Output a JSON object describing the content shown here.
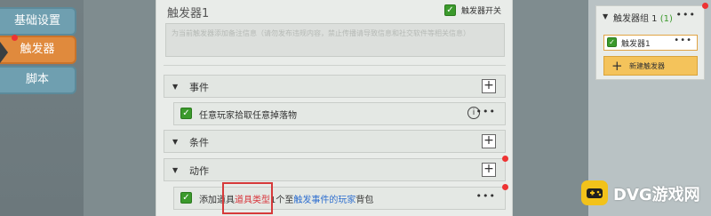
{
  "left_tabs": [
    {
      "label": "基础设置"
    },
    {
      "label": "触发器"
    },
    {
      "label": "脚本"
    }
  ],
  "trigger": {
    "title": "触发器1",
    "switch_label": "触发器开关",
    "switch_on": true,
    "note_placeholder": "为当前触发器添加备注信息（请勿发布违规内容，禁止传播请导致信息和社交软件等相关信息）"
  },
  "sections": {
    "event": {
      "label": "事件",
      "add": "+"
    },
    "condition": {
      "label": "条件",
      "add": "+"
    },
    "action": {
      "label": "动作",
      "add": "+"
    }
  },
  "event_row": {
    "text": "任意玩家拾取任意掉落物",
    "info": "i",
    "more": "•••"
  },
  "action_row": {
    "prefix": "添加道具",
    "item_type": "道具类型",
    "count": "1个至",
    "target": "触发事件的玩家",
    "suffix": "背包",
    "more": "•••"
  },
  "right_panel": {
    "group_label": "触发器组 1",
    "group_count": "(1)",
    "group_more": "•••",
    "item_label": "触发器1",
    "item_more": "•••",
    "new_button_label": "新建触发器",
    "new_button_icon": "+"
  },
  "watermark": {
    "text": "DVG游戏网"
  },
  "colors": {
    "accent_orange": "#e08a3d",
    "check_green": "#3b9a2c",
    "highlight_red": "#d8343a",
    "highlight_blue": "#2f6fcf",
    "button_yellow": "#f4c35b"
  }
}
